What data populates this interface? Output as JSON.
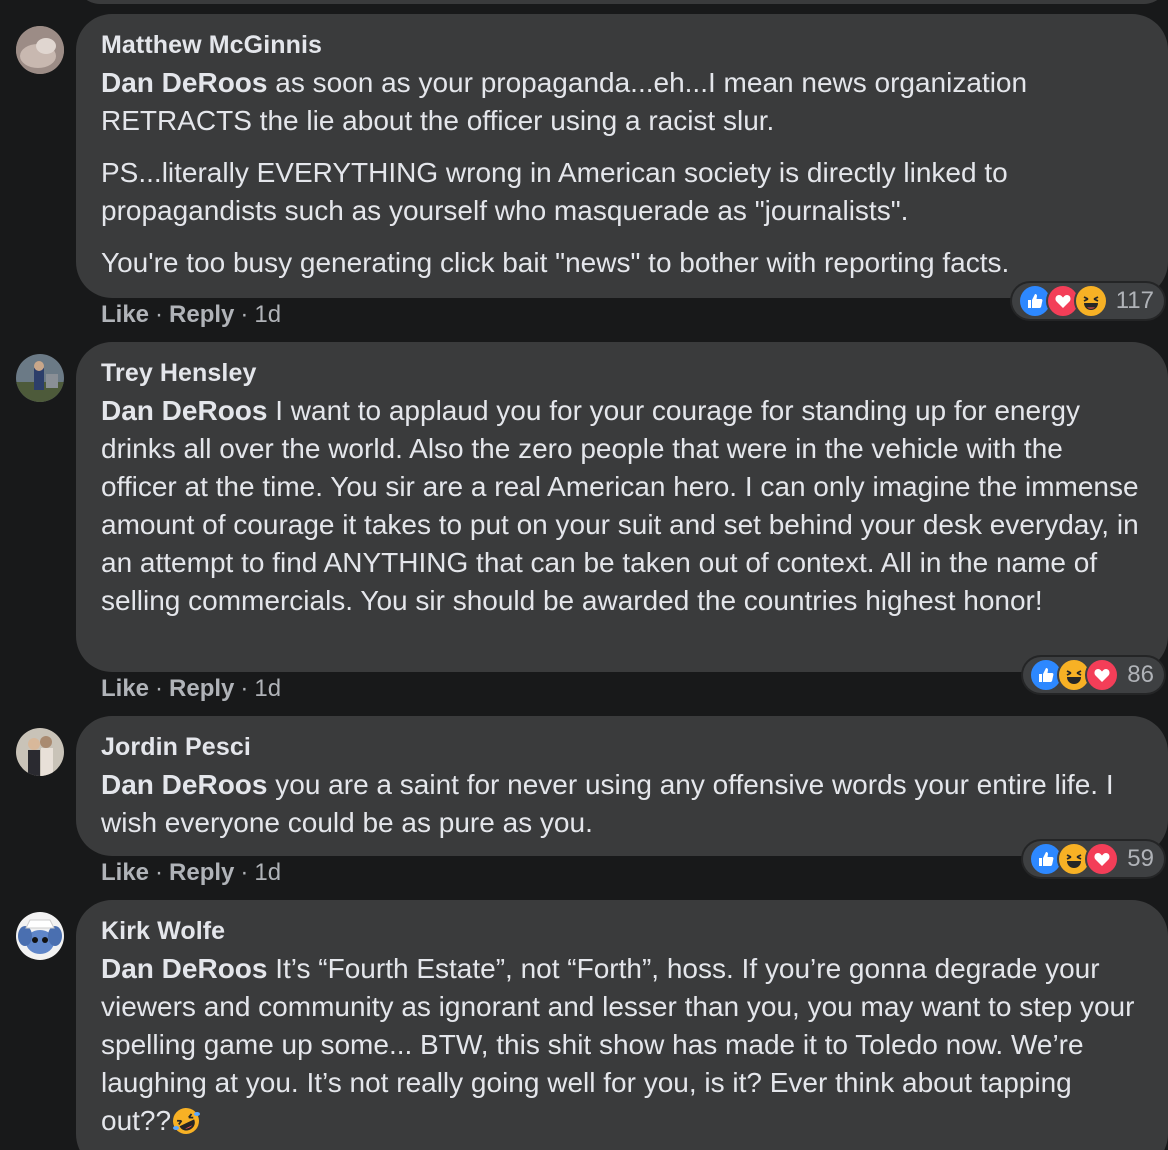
{
  "reaction_colors": {
    "like": "#2d88ff",
    "love": "#f33e58",
    "haha": "#f7b125"
  },
  "icons": {
    "like": "thumbs-up-icon",
    "love": "heart-icon",
    "haha": "laughing-face-icon"
  },
  "actions": {
    "like": "Like",
    "reply": "Reply",
    "dot": "·"
  },
  "comments": [
    {
      "author": "Matthew McGinnis",
      "mention": "Dan DeRoos",
      "paragraphs": [
        " as soon as your propaganda...eh...I mean news organization RETRACTS the lie about the officer using a racist slur.",
        "PS...literally EVERYTHING wrong in American society is directly linked to propagandists such as yourself who masquerade as \"journalists\".",
        "You're too busy generating click bait \"news\" to bother with reporting facts."
      ],
      "time": "1d",
      "reactions": [
        "like",
        "love",
        "haha"
      ],
      "reaction_count": "117"
    },
    {
      "author": "Trey Hensley",
      "mention": "Dan DeRoos",
      "paragraphs": [
        " I want to applaud you for your courage for standing up for energy drinks all over the world. Also the zero people that were in the vehicle with the officer at the time. You sir are a real American hero. I can only imagine the immense amount of courage it takes to put on your suit and set behind your desk everyday, in an attempt to find ANYTHING that can be taken out of context. All in the name of selling commercials. You sir should be awarded the countries highest honor!"
      ],
      "time": "1d",
      "reactions": [
        "like",
        "haha",
        "love"
      ],
      "reaction_count": "86"
    },
    {
      "author": "Jordin Pesci",
      "mention": "Dan DeRoos",
      "paragraphs": [
        " you are a saint for never using any offensive words your entire life. I wish everyone could be as pure as you."
      ],
      "time": "1d",
      "reactions": [
        "like",
        "haha",
        "love"
      ],
      "reaction_count": "59"
    },
    {
      "author": "Kirk Wolfe",
      "mention": "Dan DeRoos",
      "paragraphs": [
        " It’s “Fourth Estate”, not “Forth”, hoss. If you’re gonna degrade your viewers and community as ignorant and lesser than you, you may want to step your spelling game up some... BTW, this shit show has made it to Toledo now. We’re laughing at you. It’s not really going well for you, is it? Ever think about tapping out??"
      ],
      "trailing_emoji": "rolling-on-floor-laughing-icon"
    }
  ]
}
